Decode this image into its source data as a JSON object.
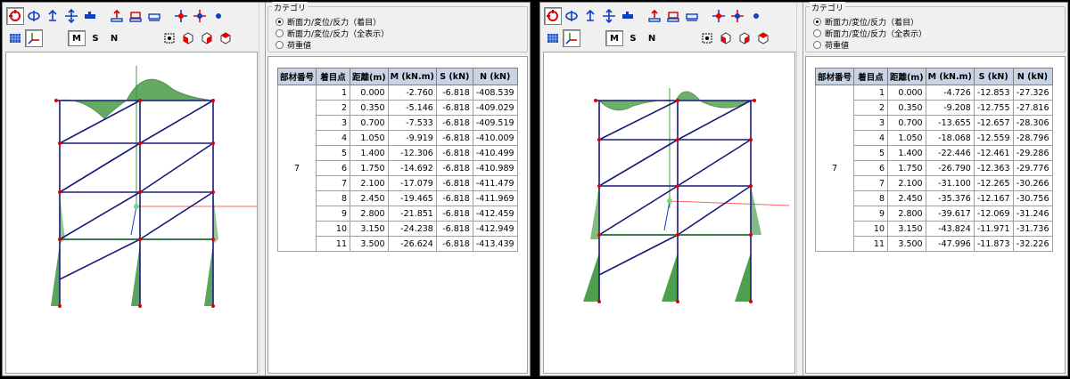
{
  "toolbar": {
    "row1_icons": [
      "rotate-icon",
      "rotate-3d-icon",
      "pan-up-icon",
      "move-icon",
      "pipe-icon",
      "load-up-icon",
      "load-box-icon",
      "support-icon",
      "node-red-icon",
      "node-star-icon",
      "point-icon"
    ],
    "row2_icons": [
      "grid-icon",
      "axis-icon"
    ],
    "toggle_M": "M",
    "toggle_S": "S",
    "toggle_N": "N",
    "row2_right_icons": [
      "select-icon",
      "cube-red-icon",
      "cube-front-icon",
      "cube-side-icon"
    ]
  },
  "category": {
    "legend": "カテゴリ",
    "options": [
      "断面力/変位/反力（着目）",
      "断面力/変位/反力（全表示）",
      "荷重値"
    ],
    "selected_index": 0
  },
  "table_headers": [
    "部材番号",
    "着目点",
    "距離(m)",
    "M (kN.m)",
    "S (kN)",
    "N (kN)"
  ],
  "left": {
    "member": "7",
    "rows": [
      [
        "1",
        "0.000",
        "-2.760",
        "-6.818",
        "-408.539"
      ],
      [
        "2",
        "0.350",
        "-5.146",
        "-6.818",
        "-409.029"
      ],
      [
        "3",
        "0.700",
        "-7.533",
        "-6.818",
        "-409.519"
      ],
      [
        "4",
        "1.050",
        "-9.919",
        "-6.818",
        "-410.009"
      ],
      [
        "5",
        "1.400",
        "-12.306",
        "-6.818",
        "-410.499"
      ],
      [
        "6",
        "1.750",
        "-14.692",
        "-6.818",
        "-410.989"
      ],
      [
        "7",
        "2.100",
        "-17.079",
        "-6.818",
        "-411.479"
      ],
      [
        "8",
        "2.450",
        "-19.465",
        "-6.818",
        "-411.969"
      ],
      [
        "9",
        "2.800",
        "-21.851",
        "-6.818",
        "-412.459"
      ],
      [
        "10",
        "3.150",
        "-24.238",
        "-6.818",
        "-412.949"
      ],
      [
        "11",
        "3.500",
        "-26.624",
        "-6.818",
        "-413.439"
      ]
    ]
  },
  "right": {
    "member": "7",
    "rows": [
      [
        "1",
        "0.000",
        "-4.726",
        "-12.853",
        "-27.326"
      ],
      [
        "2",
        "0.350",
        "-9.208",
        "-12.755",
        "-27.816"
      ],
      [
        "3",
        "0.700",
        "-13.655",
        "-12.657",
        "-28.306"
      ],
      [
        "4",
        "1.050",
        "-18.068",
        "-12.559",
        "-28.796"
      ],
      [
        "5",
        "1.400",
        "-22.446",
        "-12.461",
        "-29.286"
      ],
      [
        "6",
        "1.750",
        "-26.790",
        "-12.363",
        "-29.776"
      ],
      [
        "7",
        "2.100",
        "-31.100",
        "-12.265",
        "-30.266"
      ],
      [
        "8",
        "2.450",
        "-35.376",
        "-12.167",
        "-30.756"
      ],
      [
        "9",
        "2.800",
        "-39.617",
        "-12.069",
        "-31.246"
      ],
      [
        "10",
        "3.150",
        "-43.824",
        "-11.971",
        "-31.736"
      ],
      [
        "11",
        "3.500",
        "-47.996",
        "-11.873",
        "-32.226"
      ]
    ]
  },
  "colors": {
    "frame_line": "#1a1a7a",
    "diagram_fill": "#2f8f2f",
    "node": "#e00000",
    "axis_x": "#ff6060",
    "axis_y": "#40a040"
  }
}
